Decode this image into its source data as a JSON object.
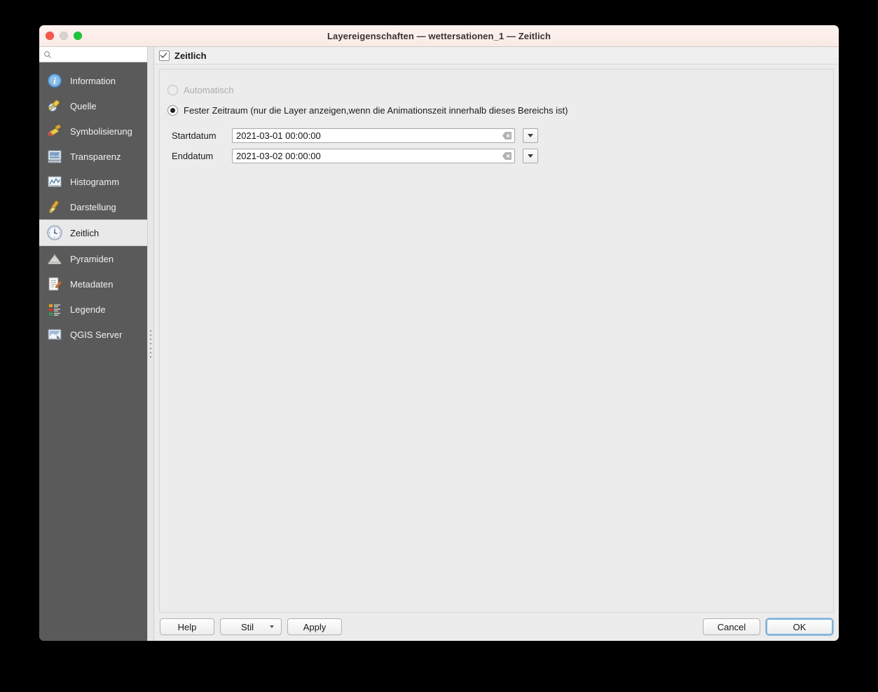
{
  "window": {
    "title": "Layereigenschaften  — wettersationen_1 — Zeitlich",
    "traffic_lights": [
      "close",
      "minimize",
      "zoom"
    ]
  },
  "sidebar": {
    "search": {
      "placeholder": "",
      "value": "",
      "icon": "search-icon"
    },
    "items": [
      {
        "label": "Information",
        "icon": "information-icon",
        "selected": false
      },
      {
        "label": "Quelle",
        "icon": "source-wrench-icon",
        "selected": false
      },
      {
        "label": "Symbolisierung",
        "icon": "symbology-brush-icon",
        "selected": false
      },
      {
        "label": "Transparenz",
        "icon": "transparency-icon",
        "selected": false
      },
      {
        "label": "Histogramm",
        "icon": "histogram-icon",
        "selected": false
      },
      {
        "label": "Darstellung",
        "icon": "rendering-brush-icon",
        "selected": false
      },
      {
        "label": "Zeitlich",
        "icon": "clock-icon",
        "selected": true
      },
      {
        "label": "Pyramiden",
        "icon": "pyramids-icon",
        "selected": false
      },
      {
        "label": "Metadaten",
        "icon": "metadata-icon",
        "selected": false
      },
      {
        "label": "Legende",
        "icon": "legend-icon",
        "selected": false
      },
      {
        "label": "QGIS Server",
        "icon": "qgis-server-icon",
        "selected": false
      }
    ]
  },
  "main": {
    "enable_checkbox": {
      "label": "Zeitlich",
      "checked": true
    },
    "mode_options": [
      {
        "label": "Automatisch",
        "selected": false,
        "disabled": true
      },
      {
        "label": "Fester Zeitraum (nur die Layer anzeigen,wenn die Animationszeit innerhalb dieses Bereichs ist)",
        "selected": true,
        "disabled": false
      }
    ],
    "fields": [
      {
        "label": "Startdatum",
        "value": "2021-03-01 00:00:00",
        "clear_icon": "clear-icon",
        "dropdown_icon": "chevron-down-icon"
      },
      {
        "label": "Enddatum",
        "value": "2021-03-02 00:00:00",
        "clear_icon": "clear-icon",
        "dropdown_icon": "chevron-down-icon"
      }
    ]
  },
  "buttons": {
    "help": "Help",
    "style": "Stil",
    "apply": "Apply",
    "cancel": "Cancel",
    "ok": "OK"
  },
  "colors": {
    "sidebar_bg": "#5a5a5a",
    "panel_bg": "#ececec",
    "titlebar_bg": "#fdf2f0",
    "selection_bg": "#e9e9e9",
    "focus_ring": "#7eb3e0"
  }
}
